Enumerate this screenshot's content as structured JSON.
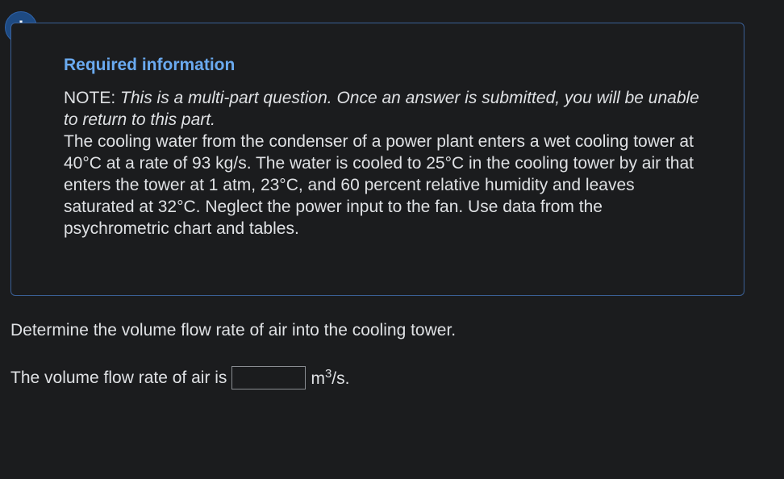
{
  "alert": {
    "icon": "exclamation-icon",
    "symbol": "!"
  },
  "info": {
    "title": "Required information",
    "note_label": "NOTE: ",
    "note_text": "This is a multi-part question. Once an answer is submitted, you will be unable to return to this part.",
    "body": "The cooling water from the condenser of a power plant enters a wet cooling tower at 40°C at a rate of 93 kg/s. The water is cooled to 25°C in the cooling tower by air that enters the tower at 1 atm, 23°C, and 60 percent relative humidity and leaves saturated at 32°C. Neglect the power input to the fan. Use data from the psychrometric chart and tables."
  },
  "question": {
    "prompt": "Determine the volume flow rate of air into the cooling tower.",
    "answer_label": "The volume flow rate of air is",
    "answer_value": "",
    "unit_base": "m",
    "unit_exp": "3",
    "unit_tail": "/s."
  },
  "colors": {
    "background": "#1b1c1e",
    "accent": "#6aaaf0",
    "badge": "#1e4a82",
    "border": "#3a5f95"
  }
}
